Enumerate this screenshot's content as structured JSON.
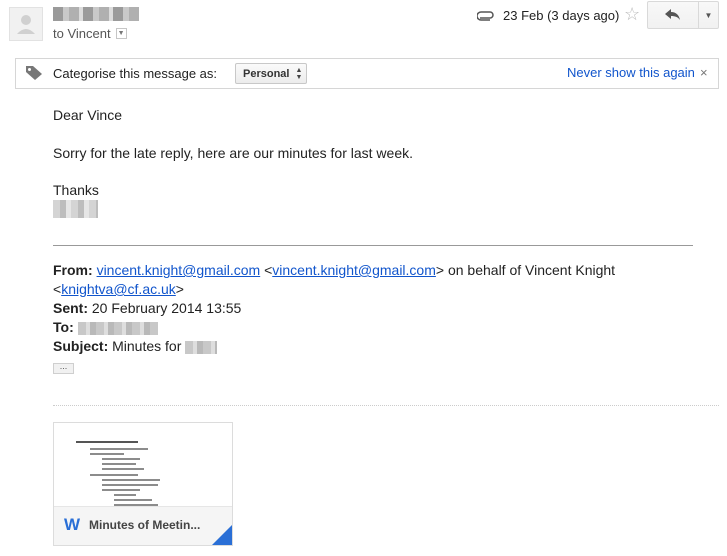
{
  "message": {
    "to_label": "to Vincent",
    "date": "23 Feb (3 days ago)"
  },
  "category_bar": {
    "label": "Categorise this message as:",
    "selected": "Personal",
    "never_show": "Never show this again",
    "close": "×"
  },
  "body": {
    "greeting": "Dear Vince",
    "line1": "Sorry for the late reply, here are our minutes for last week.",
    "closing": "Thanks"
  },
  "forwarded": {
    "from_label": "From:",
    "from_email": "vincent.knight@gmail.com",
    "from_email_bracket": "vincent.knight@gmail.com",
    "on_behalf": "on behalf of Vincent Knight",
    "alt_email": "knightva@cf.ac.uk",
    "sent_label": "Sent:",
    "sent_value": "20 February 2014 13:55",
    "to_label": "To:",
    "subject_label": "Subject:",
    "subject_value": "Minutes for",
    "ellipsis": "..."
  },
  "attachment": {
    "name": "Minutes of Meetin...",
    "icon": "W"
  },
  "icons": [
    "avatar-placeholder",
    "paperclip-icon",
    "star-icon",
    "reply-icon",
    "chevron-down-icon",
    "tag-icon",
    "close-icon",
    "word-doc-icon"
  ]
}
